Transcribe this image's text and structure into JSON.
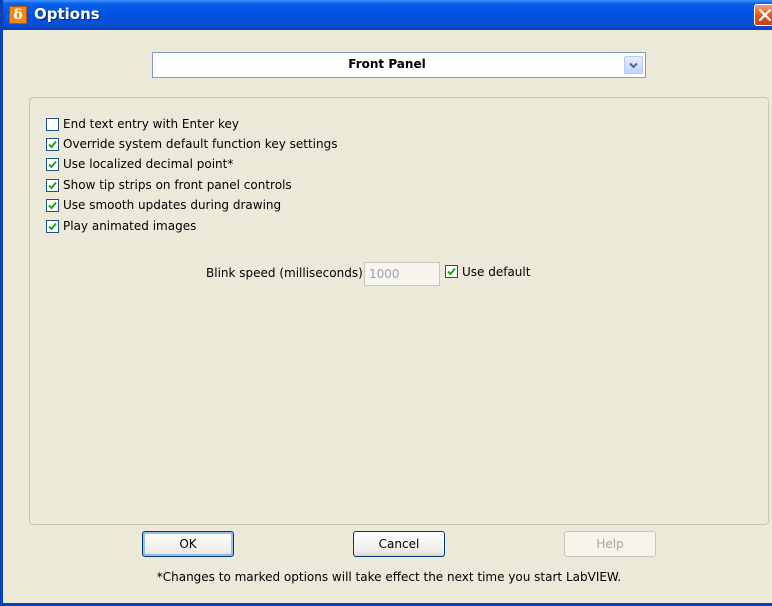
{
  "window": {
    "title": "Options",
    "app_icon_glyph": "δ",
    "app_icon": "labview-icon",
    "close_icon": "close-icon"
  },
  "category_select": {
    "selected": "Front Panel",
    "arrow_icon": "chevron-down-icon"
  },
  "options": [
    {
      "label": "End text entry with Enter key",
      "checked": false
    },
    {
      "label": "Override system default function key settings",
      "checked": true
    },
    {
      "label": "Use localized decimal point*",
      "checked": true
    },
    {
      "label": "Show tip strips on front panel controls",
      "checked": true
    },
    {
      "label": "Use smooth updates during drawing",
      "checked": true
    },
    {
      "label": "Play animated images",
      "checked": true
    }
  ],
  "blink": {
    "label": "Blink speed (milliseconds)",
    "value": "1000",
    "use_default_label": "Use default",
    "use_default_checked": true
  },
  "buttons": {
    "ok": "OK",
    "cancel": "Cancel",
    "help": "Help"
  },
  "footnote": "*Changes to marked options will take effect the next time you start LabVIEW.",
  "colors": {
    "titlebar": "#0054e3",
    "dialog_bg": "#ece9d8",
    "checkmark": "#21a121",
    "checkbox_border": "#1c5180"
  }
}
